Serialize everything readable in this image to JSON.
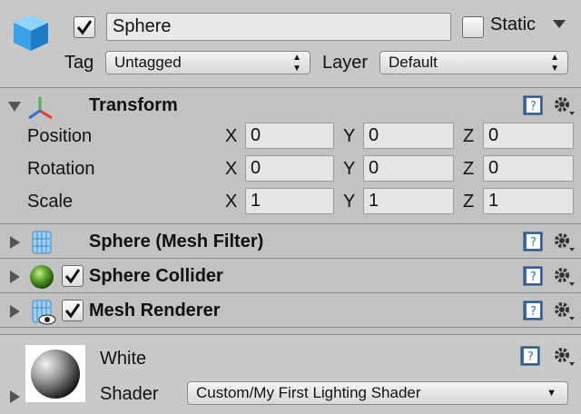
{
  "header": {
    "active": true,
    "name": "Sphere",
    "static_label": "Static",
    "static_checked": false,
    "tag_label": "Tag",
    "tag_value": "Untagged",
    "layer_label": "Layer",
    "layer_value": "Default"
  },
  "transform": {
    "title": "Transform",
    "rows": [
      {
        "label": "Position",
        "x": "0",
        "y": "0",
        "z": "0"
      },
      {
        "label": "Rotation",
        "x": "0",
        "y": "0",
        "z": "0"
      },
      {
        "label": "Scale",
        "x": "1",
        "y": "1",
        "z": "1"
      }
    ],
    "axes": {
      "x": "X",
      "y": "Y",
      "z": "Z"
    }
  },
  "components": [
    {
      "title": "Sphere (Mesh Filter)",
      "has_checkbox": false
    },
    {
      "title": "Sphere Collider",
      "has_checkbox": true,
      "checked": true
    },
    {
      "title": "Mesh Renderer",
      "has_checkbox": true,
      "checked": true
    }
  ],
  "material": {
    "name": "White",
    "shader_label": "Shader",
    "shader_value": "Custom/My First Lighting Shader"
  },
  "colors": {
    "panel_bg": "#c2c2c2",
    "help_icon_blue": "#3c6ea8",
    "cube_blue": "#39a0e6",
    "collider_green": "#5aa02c"
  }
}
